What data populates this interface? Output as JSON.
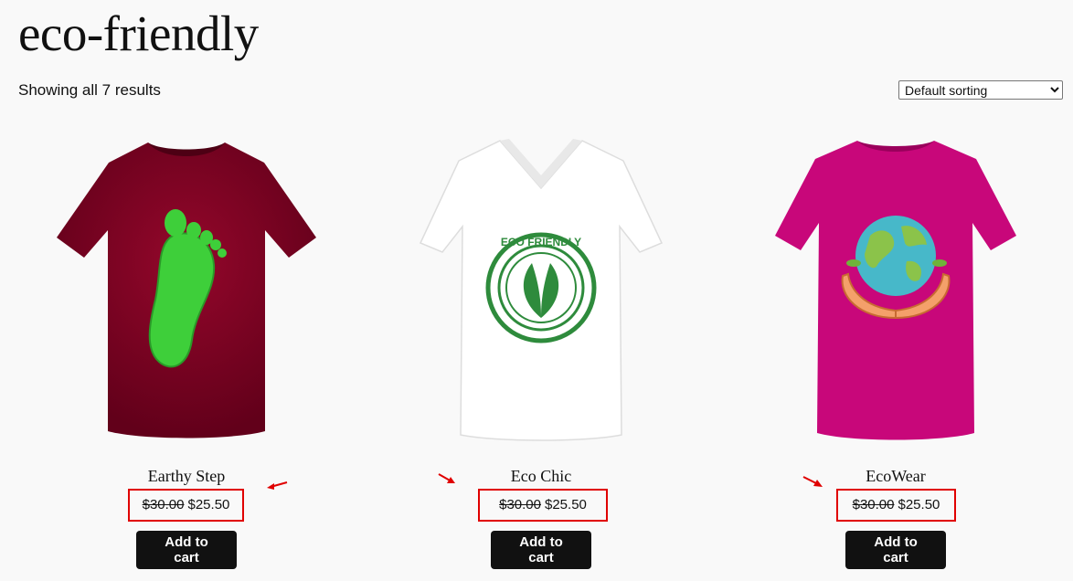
{
  "archive": {
    "title": "eco-friendly",
    "result_count": "Showing all 7 results"
  },
  "sorting": {
    "selected": "Default sorting",
    "options": [
      "Default sorting"
    ]
  },
  "products": [
    {
      "name": "Earthy Step",
      "regular_price": "$30.00",
      "sale_price": "$25.50",
      "button": "Add to cart",
      "shirt_color": "#7d0022",
      "print": "green-footprint"
    },
    {
      "name": "Eco Chic",
      "regular_price": "$30.00",
      "sale_price": "$25.50",
      "button": "Add to cart",
      "shirt_color": "#ffffff",
      "print": "eco-friendly-stamp",
      "print_text": "ECO FRIENDLY"
    },
    {
      "name": "EcoWear",
      "regular_price": "$30.00",
      "sale_price": "$25.50",
      "button": "Add to cart",
      "shirt_color": "#c8077a",
      "print": "hands-holding-globe"
    }
  ],
  "annotations": {
    "highlight_color": "#e00000"
  }
}
